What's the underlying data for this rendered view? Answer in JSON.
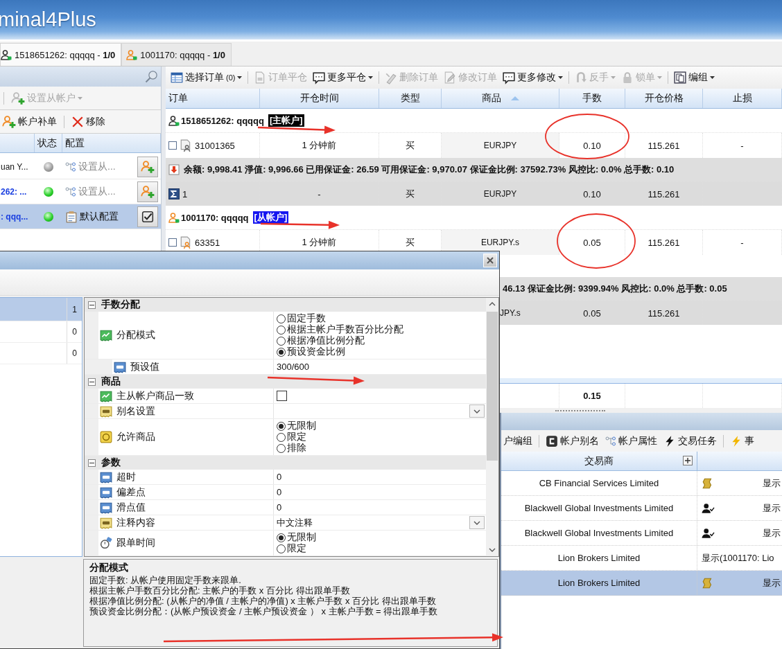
{
  "window": {
    "title": "minal4Plus"
  },
  "account_tabs": [
    {
      "kind": "master",
      "label": "1518651262: qqqqq - **1/0**",
      "selected": true
    },
    {
      "kind": "slave",
      "label": "1001170: qqqqq - **1/0**",
      "selected": false
    }
  ],
  "account_panel": {
    "toolbar_1": [
      {
        "kind": "separator"
      },
      {
        "kind": "set-slave",
        "label": "设置从帐户",
        "disabled": true,
        "dropdown": true
      }
    ],
    "toolbar_2": [
      {
        "kind": "supplement",
        "label": "帐户补单",
        "disabled": false,
        "dropdown": false
      },
      {
        "kind": "separator"
      },
      {
        "kind": "remove",
        "label": "移除",
        "disabled": false,
        "dropdown": false
      }
    ],
    "columns": [
      {
        "label": "状态"
      },
      {
        "label": "配置"
      }
    ],
    "rows": [
      {
        "account": "uan Y...",
        "online": false,
        "configured": false,
        "config": "设置从...",
        "selected": false
      },
      {
        "account": "262: ...",
        "online": true,
        "configured": false,
        "config": "设置从...",
        "selected": false
      },
      {
        "account": ": qqq...",
        "online": true,
        "configured": true,
        "config": "默认配置",
        "selected": true
      }
    ]
  },
  "orders": {
    "toolbar": [
      {
        "kind": "select",
        "label": "选择订单",
        "count": "(0)",
        "disabled": false,
        "dropdown": true
      },
      {
        "kind": "separator"
      },
      {
        "kind": "close",
        "label": "订单平仓",
        "disabled": true,
        "dropdown": false
      },
      {
        "kind": "more",
        "label": "更多平仓",
        "disabled": false,
        "dropdown": true
      },
      {
        "kind": "separator"
      },
      {
        "kind": "delete",
        "label": "删除订单",
        "disabled": true,
        "dropdown": false
      },
      {
        "kind": "modify",
        "label": "修改订单",
        "disabled": true,
        "dropdown": false
      },
      {
        "kind": "more",
        "label": "更多修改",
        "disabled": false,
        "dropdown": true
      },
      {
        "kind": "separator"
      },
      {
        "kind": "reverse",
        "label": "反手",
        "disabled": true,
        "dropdown": true
      },
      {
        "kind": "lock",
        "label": "锁单",
        "disabled": true,
        "dropdown": true
      },
      {
        "kind": "separator"
      },
      {
        "kind": "group",
        "label": "编组",
        "disabled": false,
        "dropdown": true
      }
    ],
    "columns": [
      {
        "label": "订单",
        "sorted": false
      },
      {
        "label": "开仓时间",
        "sorted": false
      },
      {
        "label": "类型",
        "sorted": false
      },
      {
        "label": "商品",
        "sorted": true
      },
      {
        "label": "手数",
        "sorted": false
      },
      {
        "label": "开仓价格",
        "sorted": false
      },
      {
        "label": "止损",
        "sorted": false
      }
    ],
    "groups": [
      {
        "kind": "master",
        "account": "1518651262: qqqqq",
        "role": "[主帐户]",
        "orders": [
          {
            "order": "31001365",
            "open_time": "1 分钟前",
            "type": "买",
            "product": "EURJPY",
            "lots": "0.10",
            "open_price": "115.261",
            "stop_loss": "-",
            "checked": false
          }
        ],
        "summary": "余额: 9,998.41 淨值: 9,996.66 已用保证金: 26.59 可用保证金: 9,970.07 保证金比例: 37592.73% 风控比: 0.0% 总手数: 0.10",
        "total": {
          "order": "1",
          "open_time": "-",
          "type": "买",
          "product": "EURJPY",
          "lots": "0.10",
          "open_price": "115.261"
        }
      },
      {
        "kind": "slave",
        "account": "1001170: qqqqq",
        "role": "[从帐户]",
        "orders": [
          {
            "order": "63351",
            "open_time": "1 分钟前",
            "type": "买",
            "product": "EURJPY.s",
            "lots": "0.05",
            "open_price": "115.261",
            "stop_loss": "-",
            "checked": false
          }
        ],
        "summary": "46.13 保证金比例: 9399.94% 风控比: 0.0% 总手数: 0.05",
        "total": {
          "product": "JPY.s",
          "lots": "0.05",
          "open_price": "115.261"
        }
      }
    ],
    "grand_total": {
      "lots": "0.15"
    }
  },
  "broker_panel": {
    "toolbar": [
      {
        "kind": "group",
        "label": "户编组"
      },
      {
        "kind": "separator"
      },
      {
        "kind": "alias",
        "label": "帐户别名"
      },
      {
        "kind": "properties",
        "label": "帐户属性"
      },
      {
        "kind": "task",
        "label": "交易任务"
      },
      {
        "kind": "separator"
      },
      {
        "kind": "event",
        "label": "事"
      }
    ],
    "columns": [
      {
        "label": "交易商"
      }
    ],
    "rows": [
      {
        "broker": "CB Financial Services Limited",
        "display": "显示",
        "selected": false
      },
      {
        "broker": "Blackwell Global Investments Limited",
        "display": "显示",
        "selected": false
      },
      {
        "broker": "Blackwell Global Investments Limited",
        "display": "显示",
        "selected": false
      },
      {
        "broker": "Lion Brokers Limited",
        "display": "显示(1001170: Lio",
        "selected": false
      },
      {
        "broker": "Lion Brokers Limited",
        "display": "显示",
        "selected": true
      }
    ]
  },
  "dialog": {
    "list": [
      {
        "count": "1",
        "selected": true
      },
      {
        "count": "0",
        "selected": false
      },
      {
        "count": "0",
        "selected": false
      }
    ],
    "categories": [
      {
        "title": "手数分配",
        "expanded": true,
        "properties": [
          {
            "kind": "radio",
            "label": "分配模式",
            "options": [
              {
                "label": "固定手数",
                "selected": false
              },
              {
                "label": "根据主帐户手数百分比分配",
                "selected": false
              },
              {
                "label": "根据净值比例分配",
                "selected": false
              },
              {
                "label": "预设资金比例",
                "selected": true
              }
            ],
            "children": [
              {
                "kind": "text",
                "label": "预设值",
                "value": "300/600"
              }
            ]
          }
        ]
      },
      {
        "title": "商品",
        "expanded": true,
        "properties": [
          {
            "kind": "checkbox",
            "label": "主从帐户商品一致",
            "checked": false
          },
          {
            "kind": "dropdown",
            "label": "别名设置"
          },
          {
            "kind": "radio",
            "label": "允许商品",
            "options": [
              {
                "label": "无限制",
                "selected": true
              },
              {
                "label": "限定",
                "selected": false
              },
              {
                "label": "排除",
                "selected": false
              }
            ]
          }
        ]
      },
      {
        "title": "参数",
        "expanded": true,
        "properties": [
          {
            "kind": "text",
            "label": "超时",
            "value": "0"
          },
          {
            "kind": "text",
            "label": "偏差点",
            "value": "0"
          },
          {
            "kind": "text",
            "label": "滑点值",
            "value": "0"
          },
          {
            "kind": "dropdown",
            "label": "注释内容",
            "value": "中文注释"
          },
          {
            "kind": "radio",
            "label": "跟单时间",
            "options": [
              {
                "label": "无限制",
                "selected": true
              },
              {
                "label": "限定",
                "selected": false
              }
            ]
          }
        ]
      }
    ],
    "description": {
      "title": "分配模式",
      "lines": [
        "固定手数: 从帐户使用固定手数来跟单.",
        "根据主帐户手数百分比分配: 主帐户的手数 x 百分比 得出跟单手数",
        "根据净值比例分配: (从帐户的净值 / 主帐户的净值) x 主帐户手数 x 百分比 得出跟单手数",
        "预设资金比例分配：(从帐户预设资金 / 主帐户预设资金 ） x 主帐户手数 = 得出跟单手数"
      ]
    }
  }
}
